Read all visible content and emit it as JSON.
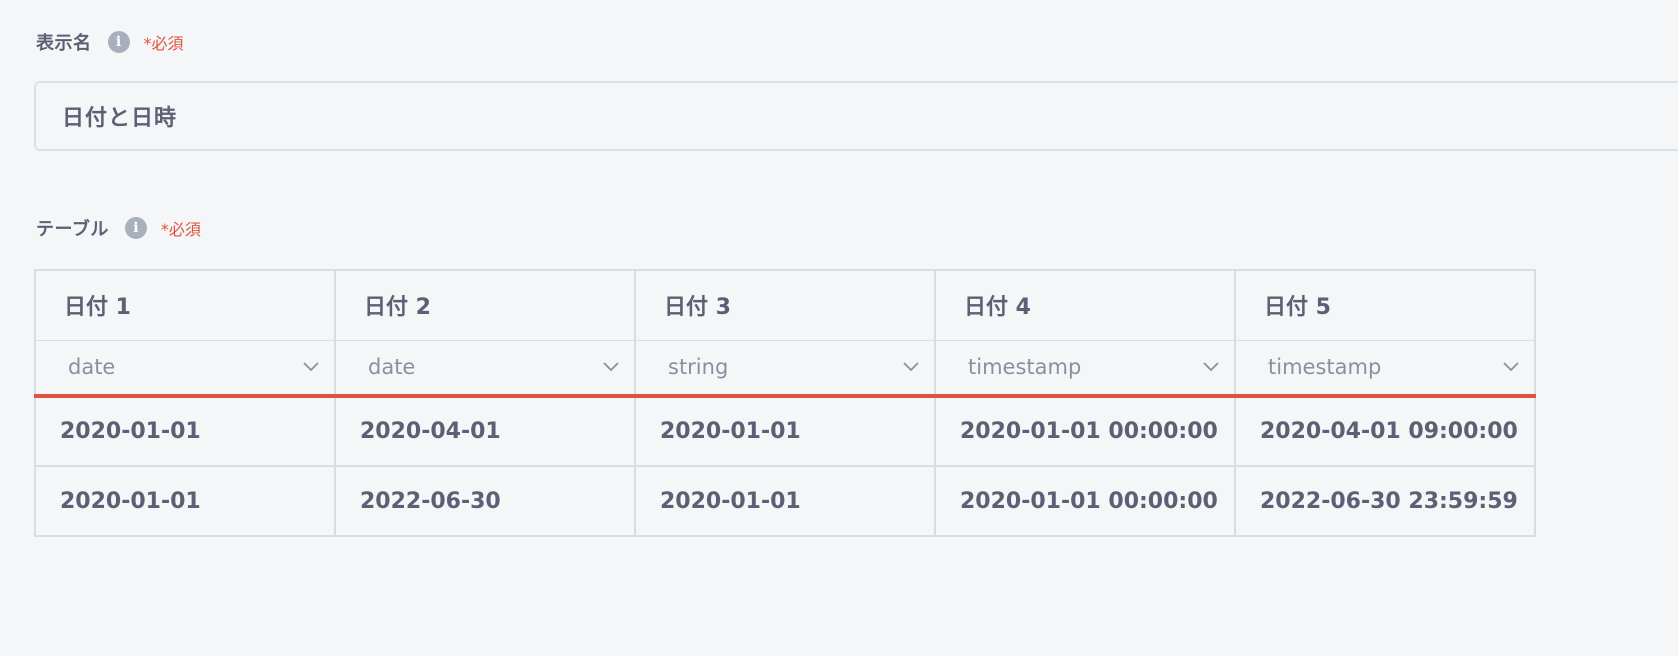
{
  "display_name": {
    "label": "表示名",
    "info_icon": "i",
    "required": "*必須",
    "value": "日付と日時"
  },
  "table_field": {
    "label": "テーブル",
    "info_icon": "i",
    "required": "*必須",
    "columns": [
      {
        "name": "日付 1",
        "type": "date"
      },
      {
        "name": "日付 2",
        "type": "date"
      },
      {
        "name": "日付 3",
        "type": "string"
      },
      {
        "name": "日付 4",
        "type": "timestamp"
      },
      {
        "name": "日付 5",
        "type": "timestamp"
      }
    ],
    "rows": [
      [
        "2020-01-01",
        "2020-04-01",
        "2020-01-01",
        "2020-01-01 00:00:00",
        "2020-04-01 09:00:00"
      ],
      [
        "2020-01-01",
        "2022-06-30",
        "2020-01-01",
        "2020-01-01 00:00:00",
        "2022-06-30 23:59:59"
      ]
    ]
  },
  "colors": {
    "required_accent": "#e0533f",
    "text": "#5b6074",
    "muted": "#8a90a0",
    "border": "#d9dce4"
  }
}
